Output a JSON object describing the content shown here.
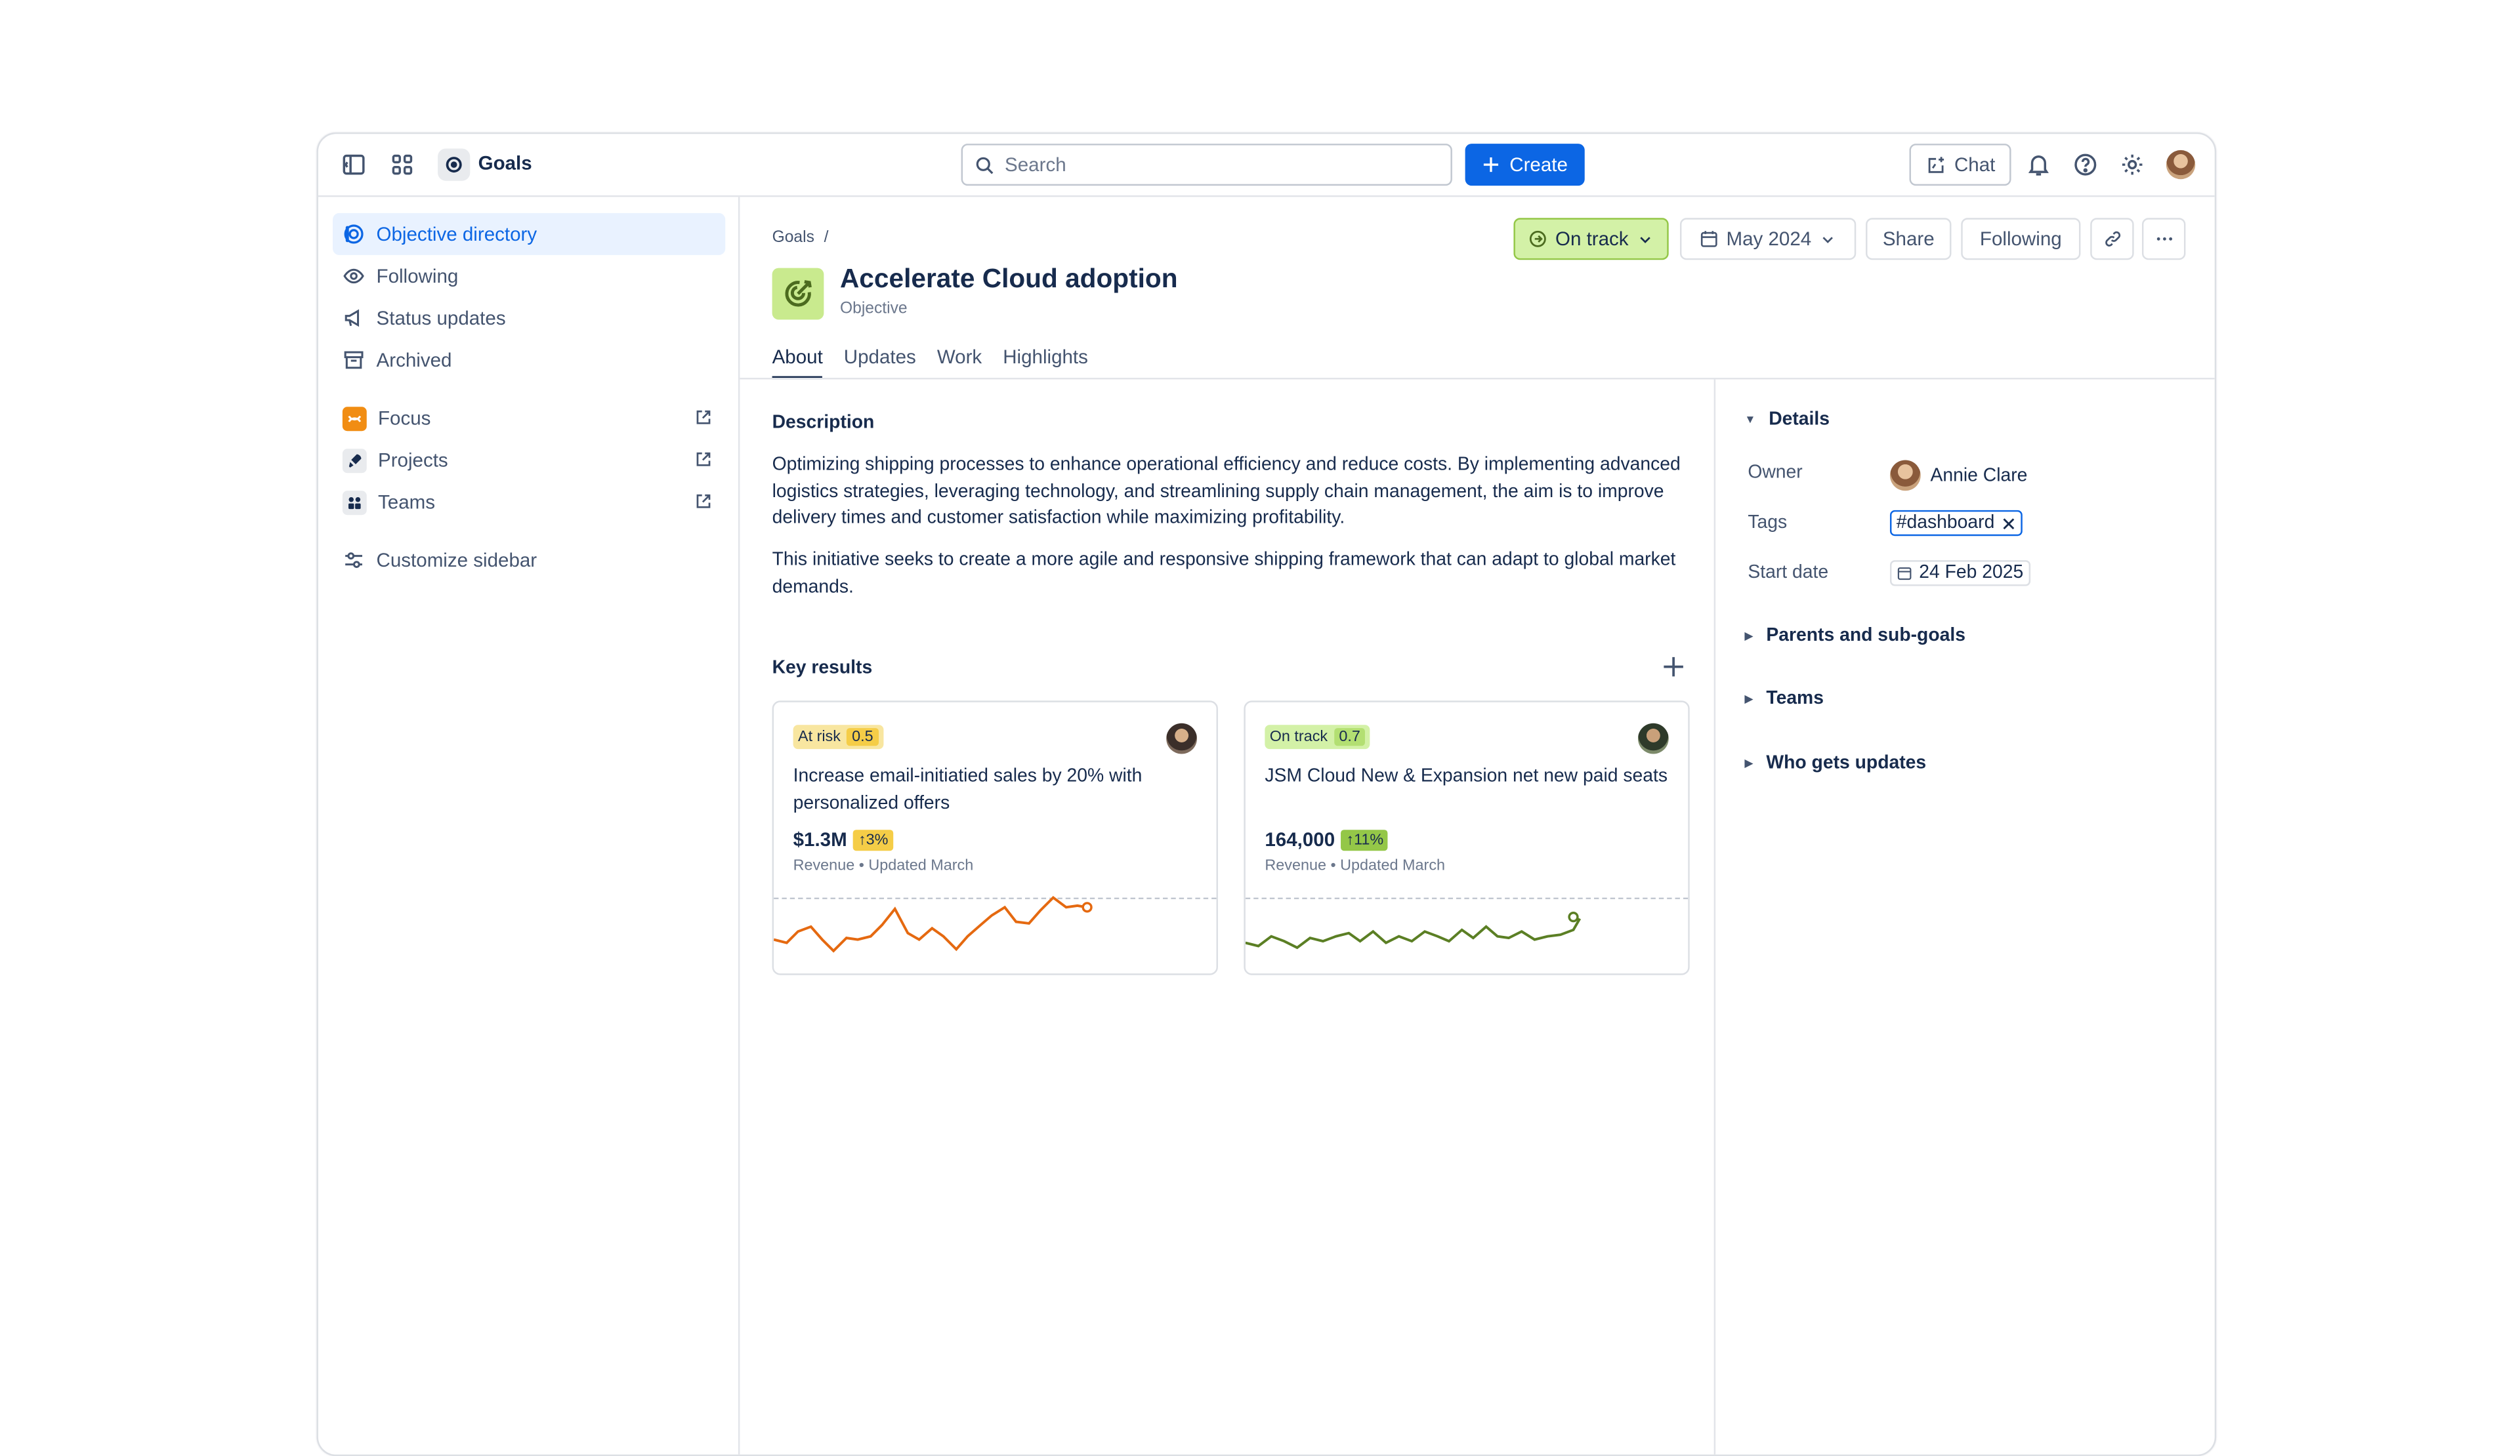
{
  "topnav": {
    "app_title": "Goals",
    "search_placeholder": "Search",
    "create_label": "Create",
    "chat_label": "Chat"
  },
  "sidebar": {
    "items": [
      {
        "label": "Objective directory",
        "icon": "target-icon",
        "active": true
      },
      {
        "label": "Following",
        "icon": "eye-icon"
      },
      {
        "label": "Status updates",
        "icon": "megaphone-icon"
      },
      {
        "label": "Archived",
        "icon": "archive-icon"
      }
    ],
    "apps": [
      {
        "label": "Focus",
        "icon": "focus-app-icon",
        "color": "#f18d13"
      },
      {
        "label": "Projects",
        "icon": "projects-rocket-icon"
      },
      {
        "label": "Teams",
        "icon": "teams-icon"
      }
    ],
    "customize_label": "Customize sidebar"
  },
  "goal": {
    "breadcrumb": "Goals",
    "breadcrumb_sep": "/",
    "title": "Accelerate Cloud adoption",
    "subtitle": "Objective",
    "status_label": "On track",
    "date_label": "May 2024",
    "share_label": "Share",
    "following_label": "Following"
  },
  "tabs": [
    "About",
    "Updates",
    "Work",
    "Highlights"
  ],
  "description": {
    "heading": "Description",
    "para1": "Optimizing shipping processes to enhance operational efficiency and reduce costs. By implementing advanced logistics strategies, leveraging technology, and streamlining supply chain management, the aim is to improve delivery times and customer satisfaction while maximizing profitability.",
    "para2": "This initiative seeks to create a more agile and responsive shipping framework that can adapt to global market demands."
  },
  "key_results": {
    "heading": "Key results",
    "cards": [
      {
        "status": "At risk",
        "score": "0.5",
        "title": "Increase email-initiatied sales by 20% with personalized offers",
        "value": "$1.3M",
        "delta": "↑3%",
        "meta": "Revenue • Updated March",
        "color": "#e56910"
      },
      {
        "status": "On track",
        "score": "0.7",
        "title": "JSM Cloud New & Expansion net new paid seats",
        "value": "164,000",
        "delta": "↑11%",
        "meta": "Revenue • Updated March",
        "color": "#5b7f24"
      }
    ]
  },
  "details": {
    "heading": "Details",
    "owner_label": "Owner",
    "owner_name": "Annie Clare",
    "tags_label": "Tags",
    "tag": "#dashboard",
    "start_label": "Start date",
    "start_date": "24 Feb 2025",
    "sections": [
      "Parents and sub-goals",
      "Teams",
      "Who gets updates"
    ]
  },
  "colors": {
    "accent": "#0c66e4",
    "on_track_bg": "#d3f1a7",
    "at_risk_bg": "#f8e6a0"
  }
}
